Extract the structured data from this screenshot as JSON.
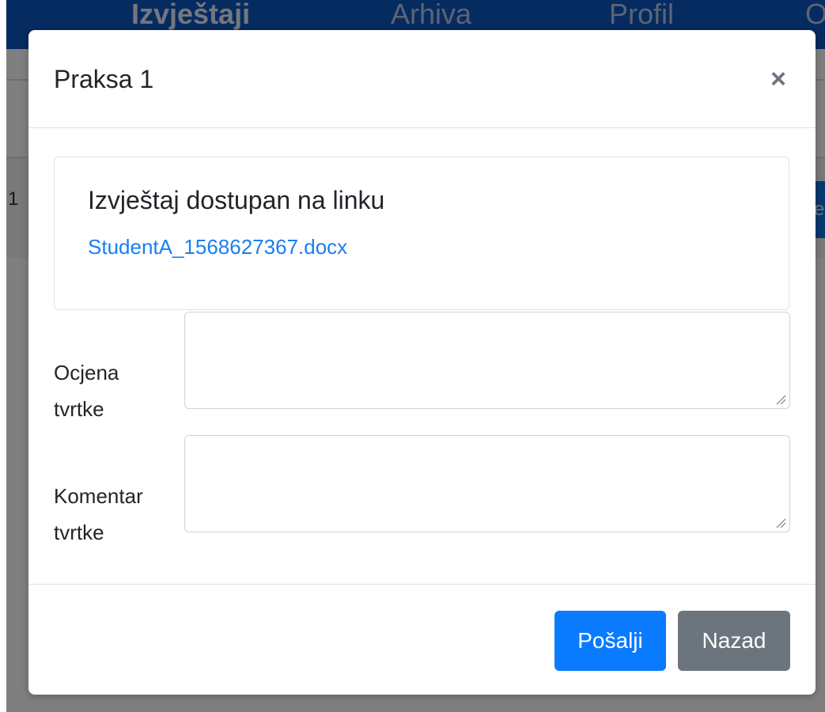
{
  "background": {
    "nav_items": [
      "Izvještaji",
      "Arhiva",
      "Profil",
      "O"
    ],
    "row_number": "1",
    "row_button_fragment": "e"
  },
  "modal": {
    "title": "Praksa 1",
    "close_glyph": "×",
    "card": {
      "title": "Izvještaj dostupan na linku",
      "link_text": "StudentA_1568627367.docx"
    },
    "fields": [
      {
        "label_line1": "Ocjena",
        "label_line2": "tvrtke",
        "value": ""
      },
      {
        "label_line1": "Komentar",
        "label_line2": "tvrtke",
        "value": ""
      }
    ],
    "footer": {
      "submit_label": "Pošalji",
      "back_label": "Nazad"
    }
  },
  "colors": {
    "primary": "#0a7bff",
    "secondary": "#6c757d",
    "link": "#1a7ff2",
    "navbar": "#0a56c2"
  }
}
